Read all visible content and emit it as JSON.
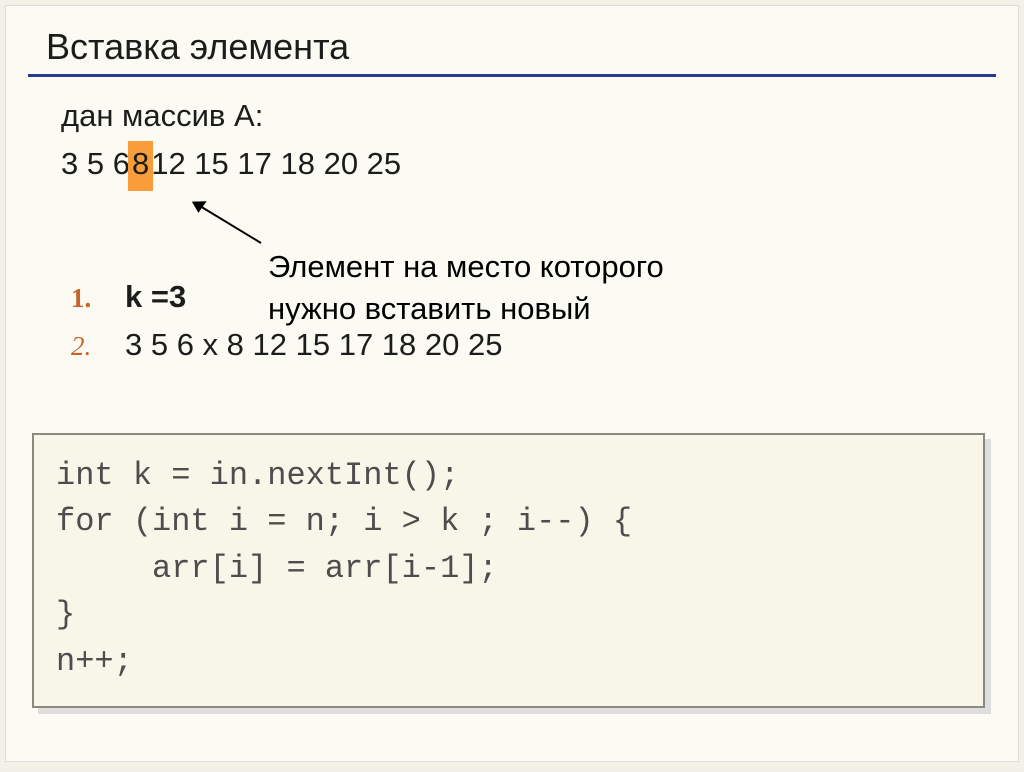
{
  "title": "Вставка элемента",
  "line1": "дан массив A:",
  "array": {
    "pre": "3  5  6",
    "hl": " 8 ",
    "post": " 12  15  17  18  20  25"
  },
  "annotation": {
    "l1": "Элемент на место которого",
    "l2": "нужно вставить новый"
  },
  "list": {
    "n1": "1.",
    "t1": "k =3",
    "n2": "2.",
    "t2": "3  5  6  x 8 12  15  17  18  20  25"
  },
  "code": {
    "l1": "int k = in.nextInt();",
    "l2": "for (int i = n; i > k ; i--) {",
    "l3": "     arr[i] = arr[i-1];",
    "l4": "}",
    "l5": "n++;"
  }
}
